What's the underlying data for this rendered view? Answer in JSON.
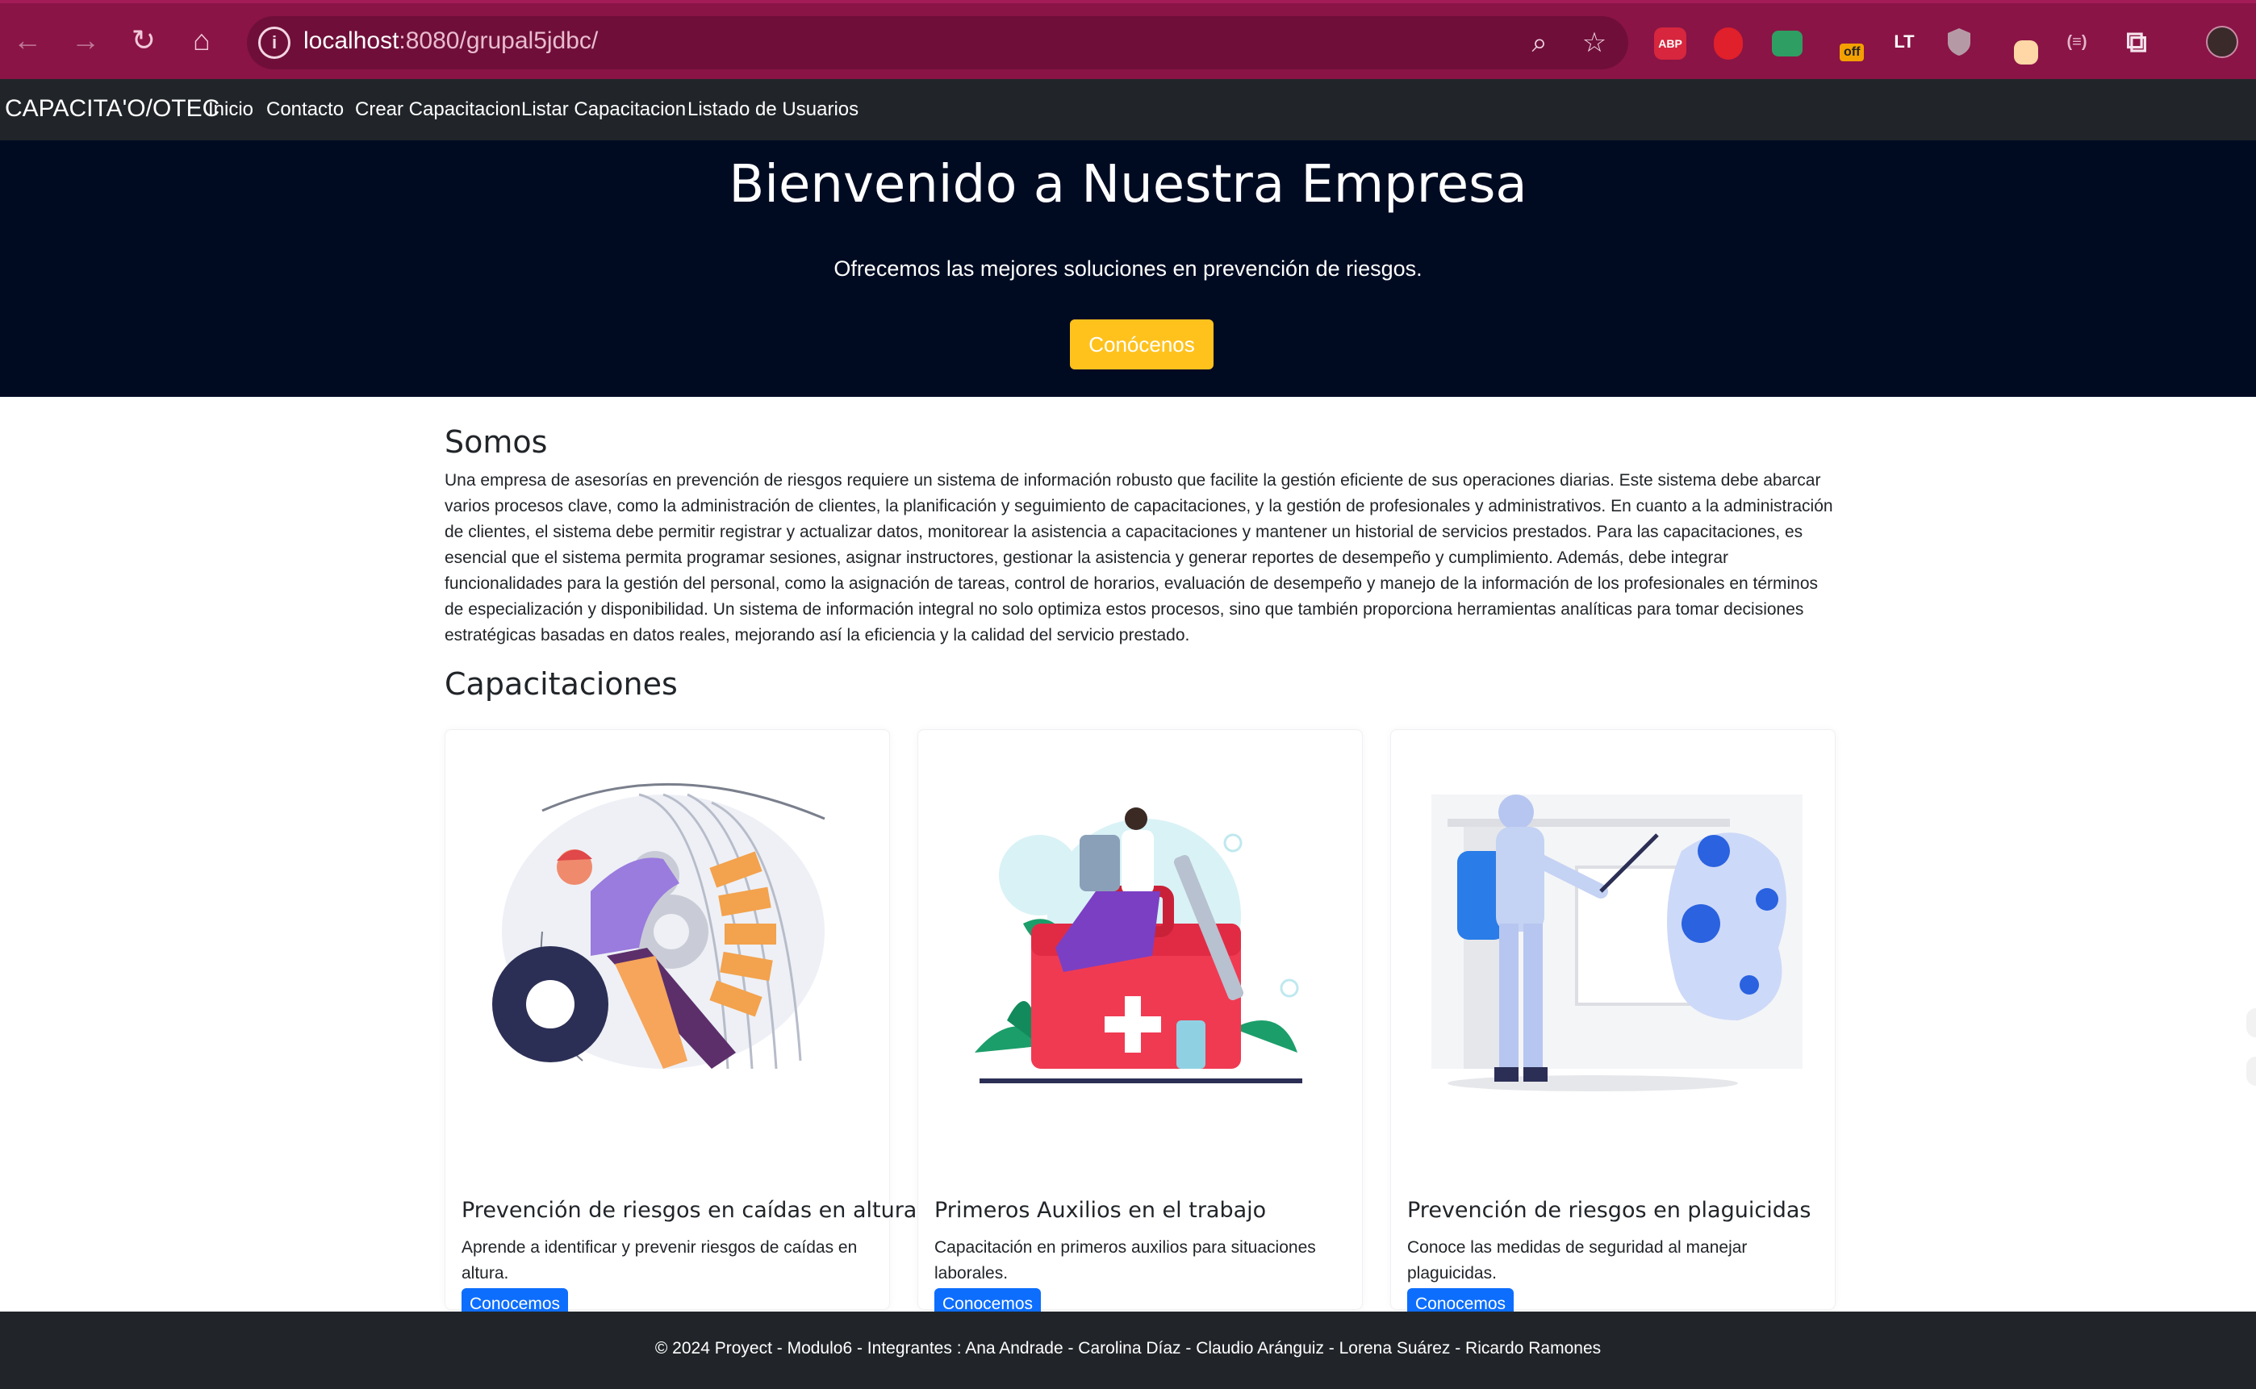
{
  "browser": {
    "url_host": "localhost",
    "url_path": ":8080/grupal5jdbc/",
    "extensions": [
      "ABP",
      "off",
      "LT",
      "(≡)"
    ]
  },
  "navbar": {
    "brand": "CAPACITA'O/OTEC",
    "links": [
      "Inicio",
      "Contacto",
      "Crear Capacitacion",
      "Listar Capacitacion",
      "Listado de Usuarios"
    ]
  },
  "hero": {
    "title": "Bienvenido a Nuestra Empresa",
    "subtitle": "Ofrecemos las mejores soluciones en prevención de riesgos.",
    "cta": "Conócenos"
  },
  "about": {
    "heading": "Somos",
    "text": "Una empresa de asesorías en prevención de riesgos requiere un sistema de información robusto que facilite la gestión eficiente de sus operaciones diarias. Este sistema debe abarcar varios procesos clave, como la administración de clientes, la planificación y seguimiento de capacitaciones, y la gestión de profesionales y administrativos. En cuanto a la administración de clientes, el sistema debe permitir registrar y actualizar datos, monitorear la asistencia a capacitaciones y mantener un historial de servicios prestados. Para las capacitaciones, es esencial que el sistema permita programar sesiones, asignar instructores, gestionar la asistencia y generar reportes de desempeño y cumplimiento. Además, debe integrar funcionalidades para la gestión del personal, como la asignación de tareas, control de horarios, evaluación de desempeño y manejo de la información de los profesionales en términos de especialización y disponibilidad. Un sistema de información integral no solo optimiza estos procesos, sino que también proporciona herramientas analíticas para tomar decisiones estratégicas basadas en datos reales, mejorando así la eficiencia y la calidad del servicio prestado."
  },
  "trainings": {
    "heading": "Capacitaciones",
    "cards": [
      {
        "title": "Prevención de riesgos en caídas en altura",
        "text": "Aprende a identificar y prevenir riesgos de caídas en altura.",
        "button": "Conocemos",
        "illustration": "climber-illustration"
      },
      {
        "title": "Primeros Auxilios en el trabajo",
        "text": "Capacitación en primeros auxilios para situaciones laborales.",
        "button": "Conocemos",
        "illustration": "first-aid-illustration"
      },
      {
        "title": "Prevención de riesgos en plaguicidas",
        "text": "Conoce las medidas de seguridad al manejar plaguicidas.",
        "button": "Conocemos",
        "illustration": "pesticide-illustration"
      }
    ]
  },
  "footer": {
    "text": "© 2024 Proyect - Modulo6 - Integrantes : Ana Andrade - Carolina Díaz - Claudio Aránguiz - Lorena Suárez - Ricardo Ramones"
  },
  "colors": {
    "chrome": "#8a1446",
    "navbar": "#212529",
    "hero": "#000b22",
    "cta": "#ffc21d",
    "primary": "#0d6efd"
  }
}
